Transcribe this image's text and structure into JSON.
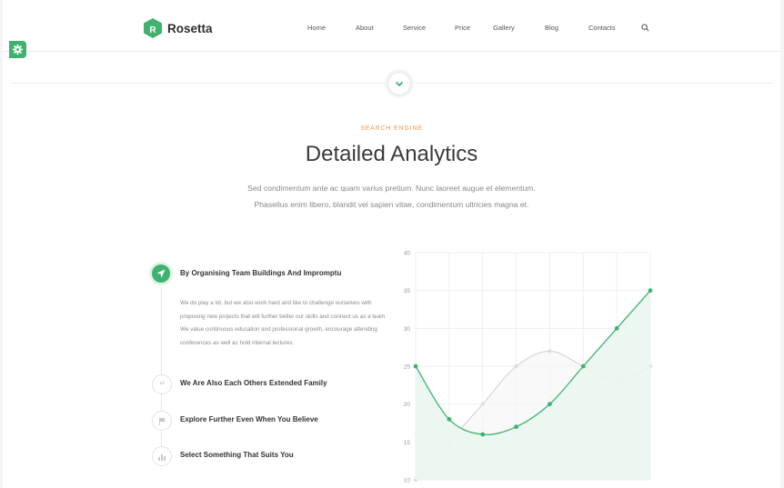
{
  "header": {
    "brand": "Rosetta",
    "nav": [
      "Home",
      "About",
      "Service",
      "Price",
      "Gallery",
      "Blog",
      "Contacts"
    ]
  },
  "icons": {
    "search": "search-icon",
    "settings": "gear-icon",
    "scroll_down": "chevron-down-icon",
    "features": [
      "rocket-icon",
      "quote-icon",
      "flag-icon",
      "chart-icon"
    ]
  },
  "colors": {
    "accent": "#3fb36e",
    "eyebrow": "#e89a53"
  },
  "section": {
    "eyebrow": "SEARCH ENGINE",
    "title": "Detailed Analytics",
    "lead_lines": [
      "Sed condimentum ante ac quam varius pretium. Nunc laoreet augue et elementum.",
      "Phasellus enim libero, blandit vel sapien vitae, condimentum ultricies magna et."
    ]
  },
  "features": [
    {
      "title": "By Organising Team Buildings And Impromptu",
      "body": "We do play a lot, but we also work hard and like to challenge ourselves with proposing new projects that will further better our skills and connect us as a team. We value continuous education and professional growth, encourage attending conferences as well as hold internal lectures."
    },
    {
      "title": "We Are Also Each Others Extended Family"
    },
    {
      "title": "Explore Further Even When You Believe"
    },
    {
      "title": "Select Something That Suits You"
    }
  ],
  "chart_data": {
    "type": "area",
    "ylim": [
      10,
      40
    ],
    "yticks": [
      10,
      15,
      20,
      25,
      30,
      35,
      40
    ],
    "x": [
      1,
      2,
      3,
      4,
      5,
      6,
      7,
      8
    ],
    "series": [
      {
        "values": [
          25,
          18,
          16,
          17,
          20,
          25,
          30,
          35
        ],
        "color": "#3fb36e"
      },
      {
        "values": [
          10,
          15,
          20,
          25,
          27,
          25,
          23,
          25
        ],
        "color": "#cfcfcf"
      }
    ]
  }
}
